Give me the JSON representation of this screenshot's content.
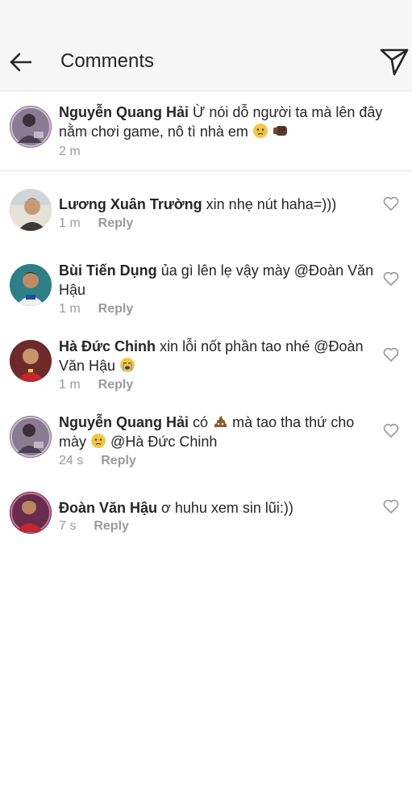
{
  "header": {
    "title": "Comments",
    "back_icon": "arrow-left-icon",
    "send_icon": "paper-plane-icon"
  },
  "caption": {
    "username": "Nguyễn Quang Hải",
    "text": "Ừ nói dỗ người ta mà lên đây nằm chơi game, nô tì nhà em",
    "emojis": [
      "crying-face-emoji",
      "fist-bump-emoji"
    ],
    "time": "2 m"
  },
  "comments": [
    {
      "username": "Lương Xuân Trường",
      "text": "xin nhẹ nút haha=)))",
      "time": "1 m",
      "reply_label": "Reply"
    },
    {
      "username": "Bùi Tiến Dụng",
      "text": "ủa gì lên lẹ vậy mày @Đoàn Văn Hậu",
      "time": "1 m",
      "reply_label": "Reply"
    },
    {
      "username": "Hà Đức Chinh",
      "text": "xin lỗi nốt phần tao nhé @Đoàn Văn Hậu",
      "emoji": "loudly-crying-emoji",
      "time": "1 m",
      "reply_label": "Reply"
    },
    {
      "username": "Nguyễn Quang Hải",
      "text_before": "có",
      "emoji_mid": "pile-of-poo-emoji",
      "text_mid": "mà tao tha thứ cho mày",
      "emoji_end": "crying-face-emoji",
      "text_after": "@Hà Đức Chinh",
      "time": "24 s",
      "reply_label": "Reply"
    },
    {
      "username": "Đoàn Văn Hậu",
      "text": "ơ huhu xem sin lũi:))",
      "time": "7 s",
      "reply_label": "Reply"
    }
  ],
  "colors": {
    "header_bg": "#f7f7f7",
    "text": "#262626",
    "meta": "#9a9a9a",
    "divider": "#e3e3e3"
  }
}
